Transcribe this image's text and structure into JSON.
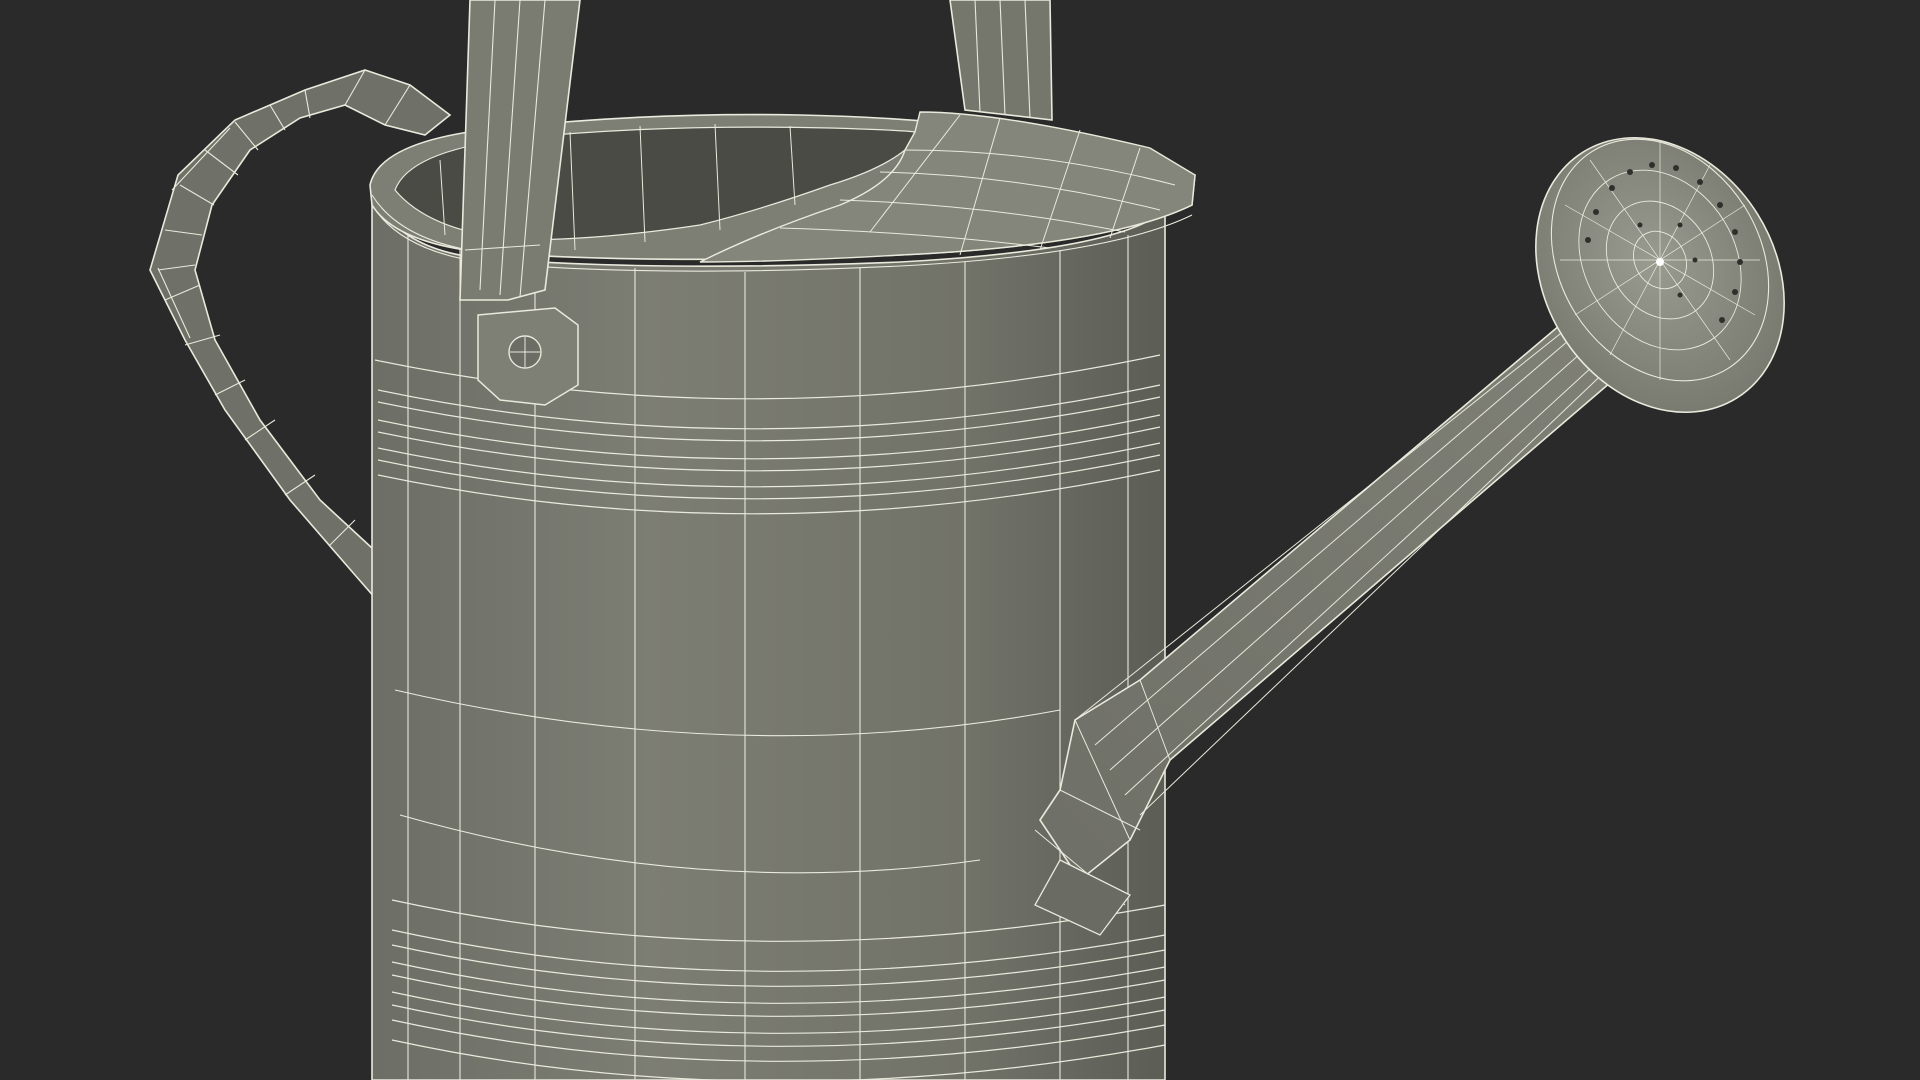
{
  "scene": {
    "subject": "watering-can-wireframe",
    "colors": {
      "background": "#2a2a2a",
      "surface": "#73746a",
      "surface_dark": "#5f6058",
      "surface_light": "#83847a",
      "wire": "#e9e9dc",
      "inner": "#4a4b44"
    }
  }
}
